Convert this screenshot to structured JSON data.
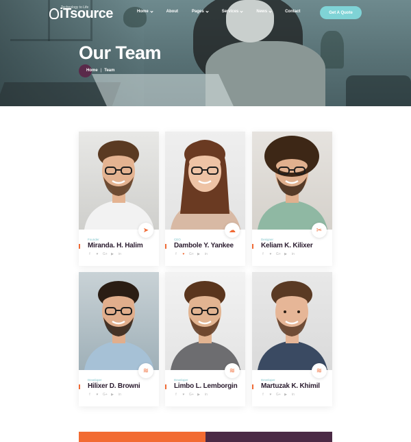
{
  "header": {
    "logo": {
      "name": "iTsource",
      "tagline": "Technology to Life"
    },
    "nav": [
      {
        "label": "Home",
        "has_caret": true
      },
      {
        "label": "About",
        "has_caret": false
      },
      {
        "label": "Pages",
        "has_caret": true
      },
      {
        "label": "Services",
        "has_caret": true
      },
      {
        "label": "News",
        "has_caret": true
      },
      {
        "label": "Contact",
        "has_caret": false
      }
    ],
    "cta": "Get A Quote"
  },
  "hero": {
    "title": "Our Team",
    "breadcrumb": [
      "Home",
      "Team"
    ],
    "separator": "|"
  },
  "team": [
    {
      "role": "Founder",
      "name": "Miranda. H. Halim",
      "badge_icon": "send-icon",
      "active_social": null
    },
    {
      "role": "CEO",
      "name": "Dambole Y. Yankee",
      "badge_icon": "cloud-icon",
      "active_social": "twitter"
    },
    {
      "role": "Designer",
      "name": "Keliam K. Kilixer",
      "badge_icon": "tools-icon",
      "active_social": null
    },
    {
      "role": "Developer",
      "name": "Hilixer D. Browni",
      "badge_icon": "layers-icon",
      "active_social": null
    },
    {
      "role": "Developer",
      "name": "Limbo L. Lemborgin",
      "badge_icon": "layers-icon",
      "active_social": null
    },
    {
      "role": "Developer",
      "name": "Martuzak K. Khimil",
      "badge_icon": "layers-icon",
      "active_social": null
    }
  ],
  "socials": [
    {
      "id": "facebook",
      "glyph": "f"
    },
    {
      "id": "twitter",
      "glyph": "♥"
    },
    {
      "id": "google",
      "glyph": "G+"
    },
    {
      "id": "youtube",
      "glyph": "▶"
    },
    {
      "id": "linkedin",
      "glyph": "in"
    }
  ],
  "colors": {
    "accent": "#f06a35",
    "teal": "#7fd3d6",
    "purple": "#4b2a45",
    "text": "#2a1b2e"
  }
}
